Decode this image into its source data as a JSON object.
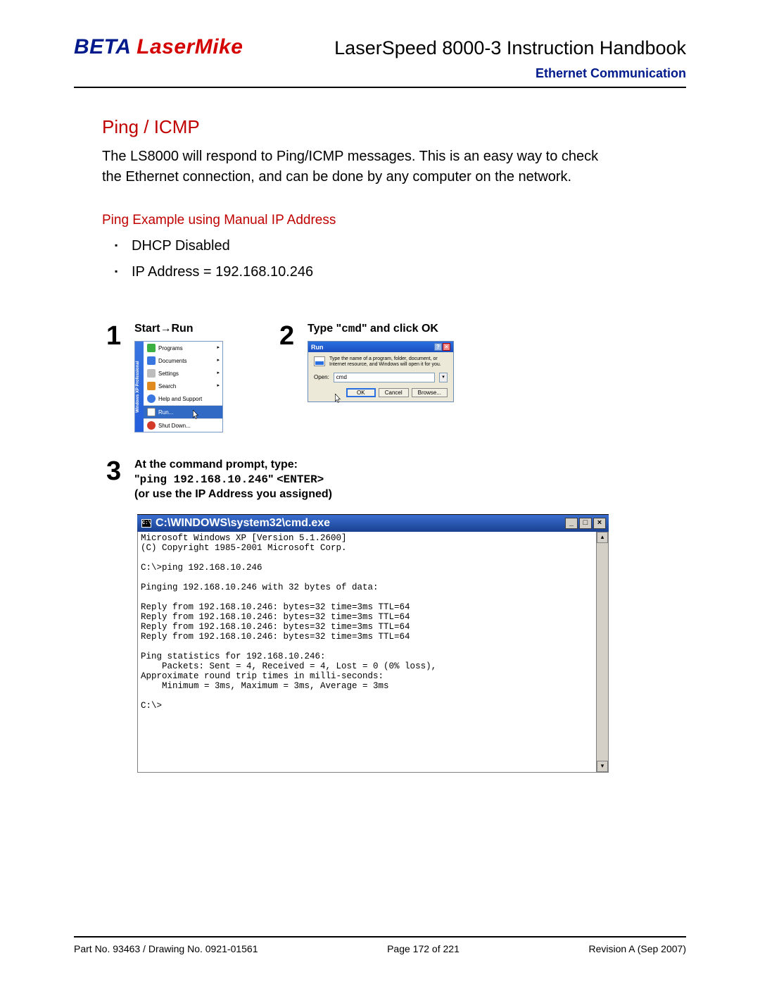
{
  "header": {
    "logo_beta": "BETA",
    "logo_rest": " LaserMike",
    "doc_title": "LaserSpeed 8000-3 Instruction Handbook",
    "subheader": "Ethernet Communication"
  },
  "section": {
    "title": "Ping / ICMP",
    "body": "The LS8000 will respond to Ping/ICMP messages.  This is an easy way to check the Ethernet connection, and can be done by any computer on the network.",
    "sub_title": "Ping Example using Manual IP Address",
    "bullets": [
      "DHCP Disabled",
      "IP Address = 192.168.10.246"
    ]
  },
  "steps": {
    "s1": {
      "num": "1",
      "title_pre": "Start",
      "title_arrow": "→",
      "title_post": "Run",
      "menu": {
        "sidebar": "Windows XP Professional",
        "items": [
          {
            "label": "Programs",
            "arrow": true
          },
          {
            "label": "Documents",
            "arrow": true
          },
          {
            "label": "Settings",
            "arrow": true
          },
          {
            "label": "Search",
            "arrow": true
          },
          {
            "label": "Help and Support",
            "arrow": false
          },
          {
            "label": "Run...",
            "arrow": false,
            "selected": true
          },
          {
            "label": "Shut Down...",
            "arrow": false
          }
        ]
      }
    },
    "s2": {
      "num": "2",
      "title_pre": "Type \"",
      "title_mono": "cmd",
      "title_post": "\" and click OK",
      "dialog": {
        "title": "Run",
        "msg": "Type the name of a program, folder, document, or Internet resource, and Windows will open it for you.",
        "open_label": "Open:",
        "input_value": "cmd",
        "btn_ok": "OK",
        "btn_cancel": "Cancel",
        "btn_browse": "Browse..."
      }
    },
    "s3": {
      "num": "3",
      "line1": "At the command prompt, type:",
      "line2_pre": "\"",
      "line2_mono": "ping 192.168.10.246",
      "line2_mid": "\" ",
      "line2_enter": "<ENTER>",
      "line3": "(or use the IP Address you assigned)",
      "cmd": {
        "titlebar": "C:\\WINDOWS\\system32\\cmd.exe",
        "output": "Microsoft Windows XP [Version 5.1.2600]\n(C) Copyright 1985-2001 Microsoft Corp.\n\nC:\\>ping 192.168.10.246\n\nPinging 192.168.10.246 with 32 bytes of data:\n\nReply from 192.168.10.246: bytes=32 time=3ms TTL=64\nReply from 192.168.10.246: bytes=32 time=3ms TTL=64\nReply from 192.168.10.246: bytes=32 time=3ms TTL=64\nReply from 192.168.10.246: bytes=32 time=3ms TTL=64\n\nPing statistics for 192.168.10.246:\n    Packets: Sent = 4, Received = 4, Lost = 0 (0% loss),\nApproximate round trip times in milli-seconds:\n    Minimum = 3ms, Maximum = 3ms, Average = 3ms\n\nC:\\>"
      }
    }
  },
  "footer": {
    "left": "Part No. 93463 / Drawing No. 0921-01561",
    "center": "Page 172 of 221",
    "right": "Revision A (Sep 2007)"
  }
}
